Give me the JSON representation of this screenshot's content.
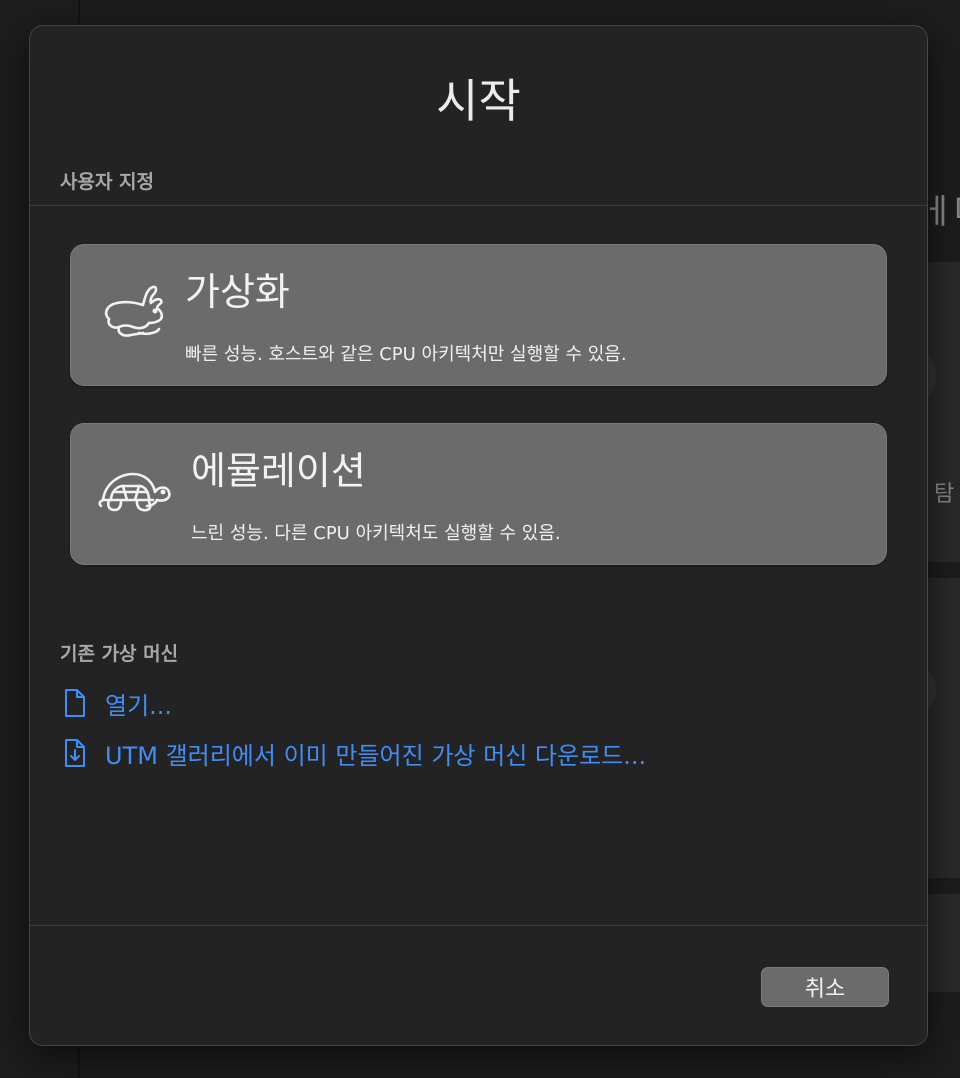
{
  "dialog": {
    "title": "시작",
    "custom_section_label": "사용자 지정",
    "options": [
      {
        "icon": "rabbit-icon",
        "title": "가상화",
        "description": "빠른 성능. 호스트와 같은 CPU 아키텍처만 실행할 수 있음."
      },
      {
        "icon": "turtle-icon",
        "title": "에뮬레이션",
        "description": "느린 성능. 다른 CPU 아키텍처도 실행할 수 있음."
      }
    ],
    "existing_section_label": "기존 가상 머신",
    "links": [
      {
        "icon": "document-icon",
        "label": "열기..."
      },
      {
        "icon": "download-document-icon",
        "label": "UTM 갤러리에서 이미 만들어진 가상 머신 다운로드..."
      }
    ],
    "cancel_label": "취소"
  },
  "background": {
    "right_heading_fragment": "ㅔ디",
    "right_label_fragment": "탐"
  },
  "colors": {
    "dialog_bg": "#232323",
    "card_bg": "#6b6b6b",
    "link": "#3f8ef5",
    "section_label": "#a8a8a8"
  }
}
